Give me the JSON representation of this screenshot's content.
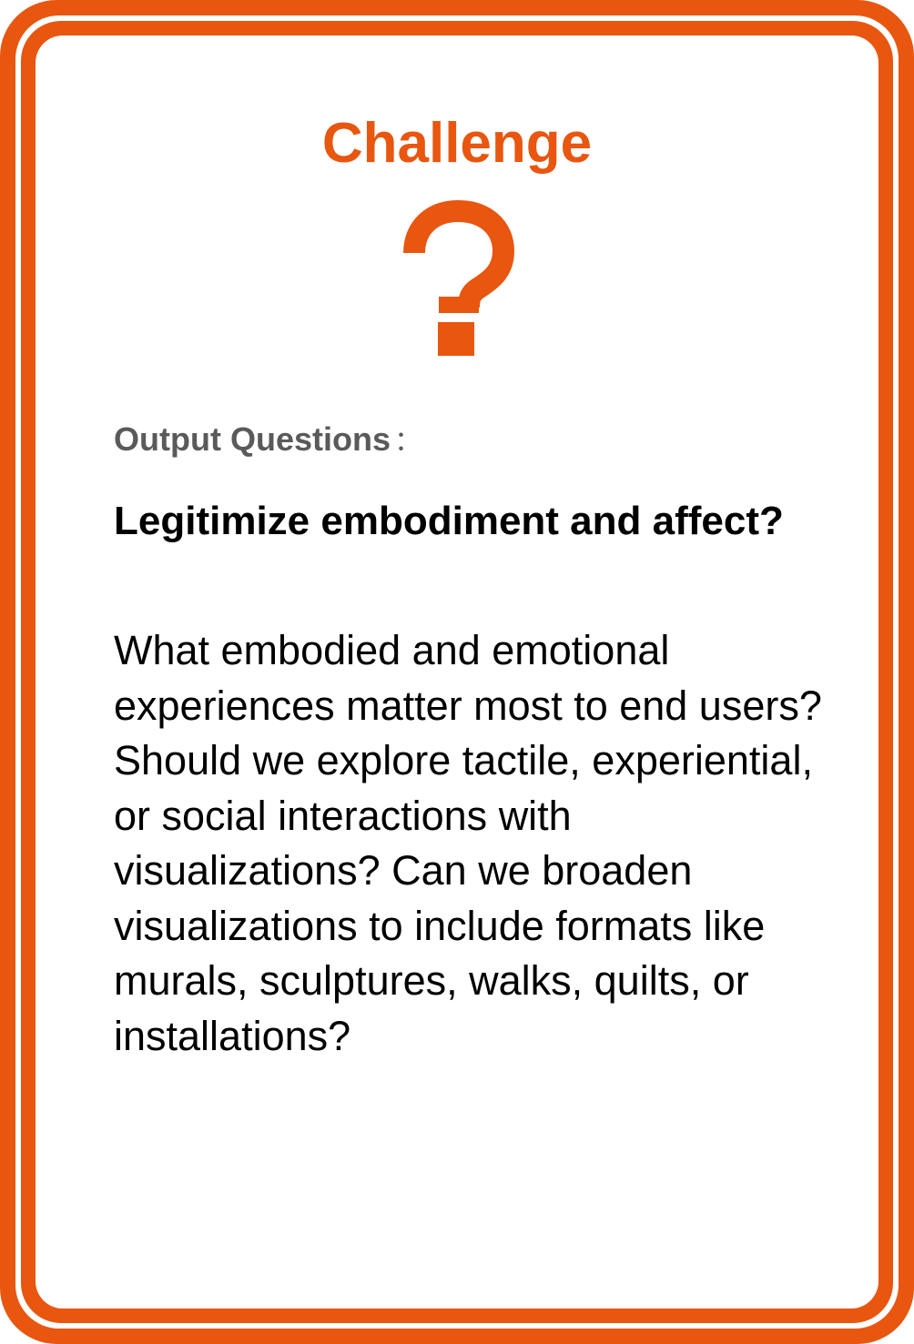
{
  "card": {
    "title": "Challenge",
    "icon": "question-mark-icon",
    "label": "Output Questions",
    "label_separator": "：",
    "heading": "Legitimize embodiment and affect?",
    "body": "What embodied and emotional experiences matter most to end users? Should we explore tactile, experiential, or social interactions with visualizations? Can we broaden visualizations to include formats like murals, sculptures, walks, quilts, or installations?"
  },
  "colors": {
    "accent": "#E8560F",
    "label": "#5A5A5A",
    "text": "#000000",
    "background": "#FFFFFF"
  }
}
